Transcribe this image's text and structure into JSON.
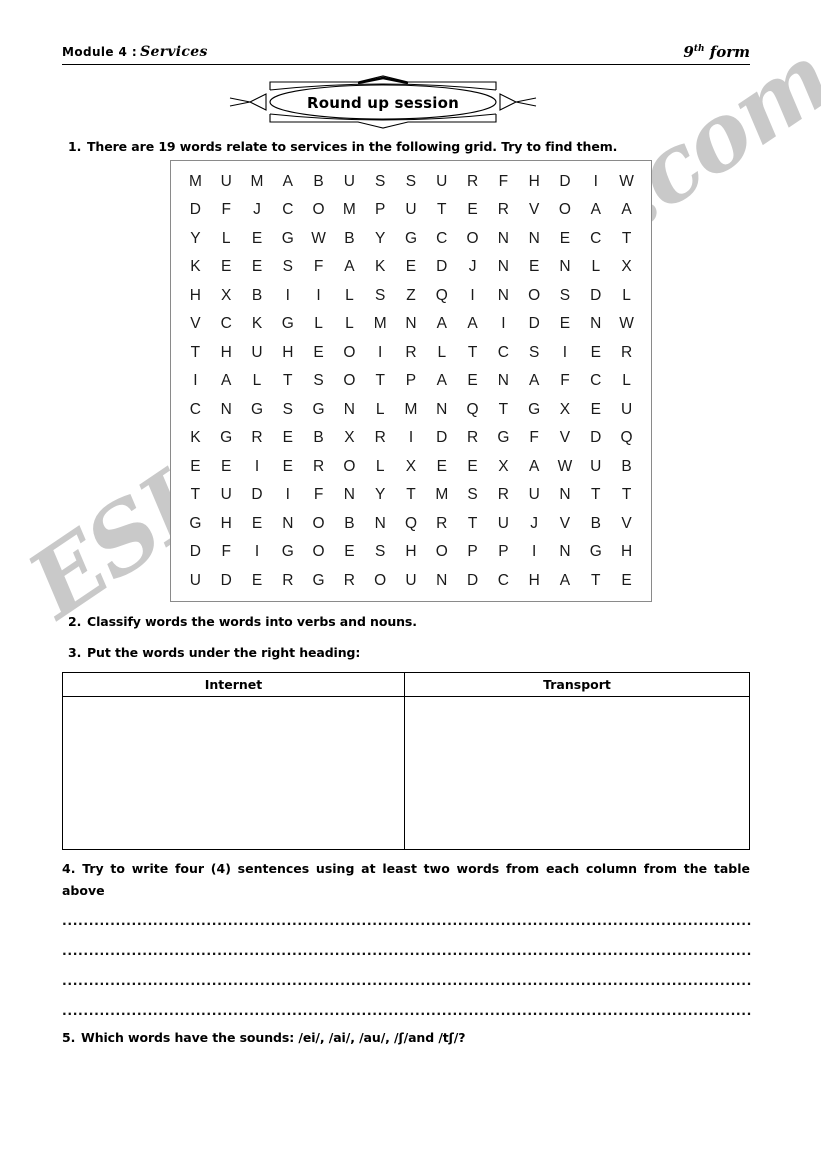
{
  "header": {
    "module_label": "Module  4 :",
    "module_title": "Services",
    "form_prefix": "9",
    "form_sup": "th",
    "form_suffix": "form"
  },
  "banner": {
    "title": "Round up session"
  },
  "questions": {
    "q1_num": "1.",
    "q1_text": "There are 19 words relate to services in the following grid. Try to find them.",
    "q2_num": "2.",
    "q2_text": "Classify words the words into verbs and nouns.",
    "q3_num": "3.",
    "q3_text": "Put the words under the right heading:",
    "q4_text": "4. Try to write four (4) sentences using at least two words from each column from the table above",
    "q5_num": "5.",
    "q5_text": "Which words have the sounds: /ei/, /ai/, /au/, /ʃ/and /tʃ/?"
  },
  "wordsearch": {
    "rows": 15,
    "cols": 14,
    "grid": [
      [
        "M",
        "U",
        "M",
        "A",
        "B",
        "U",
        "S",
        "S",
        "U",
        "R",
        "F",
        "H",
        "D",
        "I",
        "W"
      ],
      [
        "D",
        "F",
        "J",
        "C",
        "O",
        "M",
        "P",
        "U",
        "T",
        "E",
        "R",
        "V",
        "O",
        "A",
        "A"
      ],
      [
        "Y",
        "L",
        "E",
        "G",
        "W",
        "B",
        "Y",
        "G",
        "C",
        "O",
        "N",
        "N",
        "E",
        "C",
        "T"
      ],
      [
        "K",
        "E",
        "E",
        "S",
        "F",
        "A",
        "K",
        "E",
        "D",
        "J",
        "N",
        "E",
        "N",
        "L",
        "X"
      ],
      [
        "H",
        "X",
        "B",
        "I",
        "I",
        "L",
        "S",
        "Z",
        "Q",
        "I",
        "N",
        "O",
        "S",
        "D",
        "L"
      ],
      [
        "V",
        "C",
        "K",
        "G",
        "L",
        "L",
        "M",
        "N",
        "A",
        "A",
        "I",
        "D",
        "E",
        "N",
        "W"
      ],
      [
        "T",
        "H",
        "U",
        "H",
        "E",
        "O",
        "I",
        "R",
        "L",
        "T",
        "C",
        "S",
        "I",
        "E",
        "R"
      ],
      [
        "I",
        "A",
        "L",
        "T",
        "S",
        "O",
        "T",
        "P",
        "A",
        "E",
        "N",
        "A",
        "F",
        "C",
        "L"
      ],
      [
        "C",
        "N",
        "G",
        "S",
        "G",
        "N",
        "L",
        "M",
        "N",
        "Q",
        "T",
        "G",
        "X",
        "E",
        "U"
      ],
      [
        "K",
        "G",
        "R",
        "E",
        "B",
        "X",
        "R",
        "I",
        "D",
        "R",
        "G",
        "F",
        "V",
        "D",
        "Q"
      ],
      [
        "E",
        "E",
        "I",
        "E",
        "R",
        "O",
        "L",
        "X",
        "E",
        "E",
        "X",
        "A",
        "W",
        "U",
        "B"
      ],
      [
        "T",
        "U",
        "D",
        "I",
        "F",
        "N",
        "Y",
        "T",
        "M",
        "S",
        "R",
        "U",
        "N",
        "T",
        "T"
      ],
      [
        "G",
        "H",
        "E",
        "N",
        "O",
        "B",
        "N",
        "Q",
        "R",
        "T",
        "U",
        "J",
        "V",
        "B",
        "V"
      ],
      [
        "D",
        "F",
        "I",
        "G",
        "O",
        "E",
        "S",
        "H",
        "O",
        "P",
        "P",
        "I",
        "N",
        "G",
        "H"
      ],
      [
        "U",
        "D",
        "E",
        "R",
        "G",
        "R",
        "O",
        "U",
        "N",
        "D",
        "C",
        "H",
        "A",
        "T",
        "E"
      ]
    ]
  },
  "table": {
    "headers": [
      "Internet",
      "Transport"
    ],
    "cells": [
      "",
      ""
    ]
  },
  "answer_lines": {
    "dots": "...................................................................................................................................................................................................................................................................",
    "count": 4
  },
  "watermark": {
    "text": "ESLprintables.com",
    "color": "#c9c9c9"
  }
}
